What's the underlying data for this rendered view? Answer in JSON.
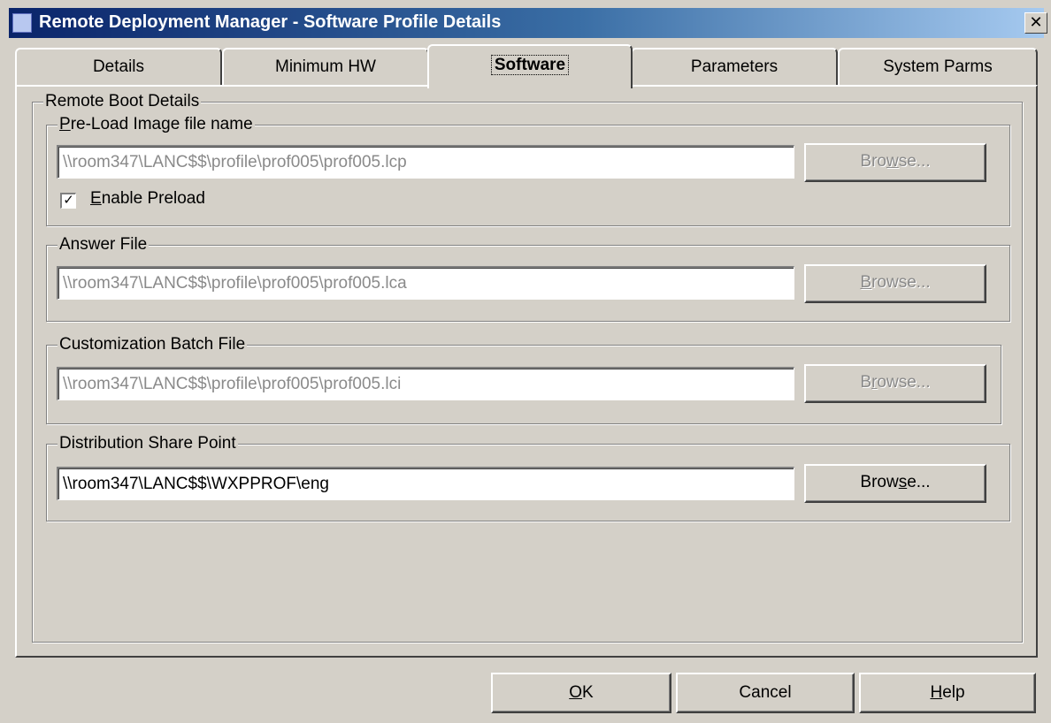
{
  "window": {
    "title": "Remote Deployment Manager - Software Profile Details",
    "close_glyph": "✕"
  },
  "tabs": [
    {
      "label": "Details"
    },
    {
      "label": "Minimum HW"
    },
    {
      "label": "Software",
      "active": true
    },
    {
      "label": "Parameters"
    },
    {
      "label": "System Parms"
    }
  ],
  "remote_boot": {
    "title": "Remote Boot Details",
    "preload": {
      "title_prefix": "P",
      "title_rest": "re-Load Image file name",
      "value": "\\\\room347\\LANC$$\\profile\\prof005\\prof005.lcp",
      "browse_pre": "Bro",
      "browse_key": "w",
      "browse_post": "se...",
      "enabled": false,
      "checkbox_key": "E",
      "checkbox_rest": "nable Preload",
      "checkbox_checked": true,
      "checkmark": "✓"
    },
    "answer": {
      "title": "Answer File",
      "value": "\\\\room347\\LANC$$\\profile\\prof005\\prof005.lca",
      "browse_pre": "",
      "browse_key": "B",
      "browse_post": "rowse...",
      "enabled": false
    },
    "customization": {
      "title": "Customization Batch File",
      "value": "\\\\room347\\LANC$$\\profile\\prof005\\prof005.lci",
      "browse_pre": "B",
      "browse_key": "r",
      "browse_post": "owse...",
      "enabled": false
    },
    "distribution": {
      "title": "Distribution Share Point",
      "value": "\\\\room347\\LANC$$\\WXPPROF\\eng",
      "browse_pre": "Brow",
      "browse_key": "s",
      "browse_post": "e...",
      "enabled": true
    }
  },
  "footer": {
    "ok_key": "O",
    "ok_rest": "K",
    "cancel": "Cancel",
    "help_key": "H",
    "help_rest": "elp"
  },
  "colors": {
    "title_gradient_start": "#0a246a",
    "title_gradient_end": "#a6caf0",
    "face": "#d4d0c8",
    "disabled_text": "#8a8a8a"
  }
}
